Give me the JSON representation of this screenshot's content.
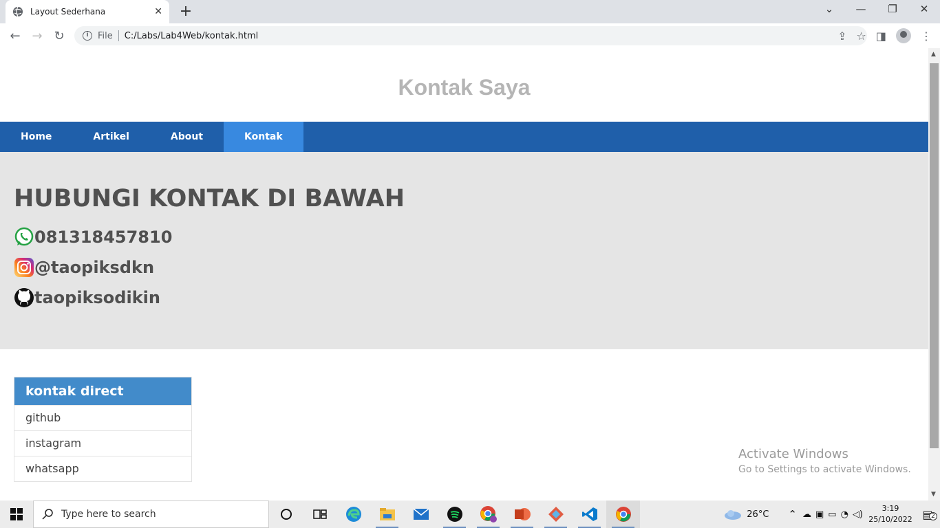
{
  "browser": {
    "tab_title": "Layout Sederhana",
    "tab_close": "✕",
    "new_tab": "+",
    "omnibox_scheme": "File",
    "url": "C:/Labs/Lab4Web/kontak.html"
  },
  "page": {
    "title": "Kontak Saya",
    "nav": [
      {
        "label": "Home"
      },
      {
        "label": "Artikel"
      },
      {
        "label": "About"
      },
      {
        "label": "Kontak"
      }
    ],
    "hero": {
      "heading": "HUBUNGI KONTAK DI BAWAH",
      "contacts": [
        {
          "icon": "whatsapp-icon",
          "text": "081318457810"
        },
        {
          "icon": "instagram-icon",
          "text": "@taopiksdkn"
        },
        {
          "icon": "github-icon",
          "text": "taopiksodikin"
        }
      ]
    },
    "sidebar": {
      "title": "kontak direct",
      "items": [
        {
          "label": "github"
        },
        {
          "label": "instagram"
        },
        {
          "label": "whatsapp"
        }
      ]
    },
    "watermark": {
      "line1": "Activate Windows",
      "line2": "Go to Settings to activate Windows."
    }
  },
  "taskbar": {
    "search_placeholder": "Type here to search",
    "weather": "26°C",
    "time": "3:19",
    "date": "25/10/2022",
    "notification_count": "2"
  },
  "colors": {
    "nav_bg": "#1f5faa",
    "nav_active": "#3889e0",
    "hero_bg": "#e5e5e5",
    "box_head": "#428bca"
  }
}
